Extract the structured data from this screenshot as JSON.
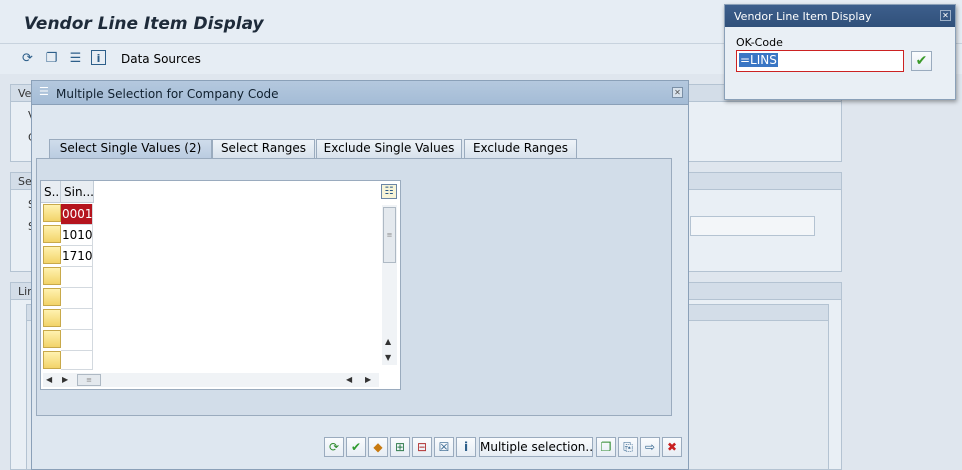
{
  "main": {
    "title": "Vendor Line Item Display",
    "toolbar": {
      "icons": [
        "execute-icon",
        "get-variant-icon",
        "dynamic-selection-icon",
        "info-icon"
      ],
      "data_sources_label": "Data Sources"
    },
    "background_fragments": [
      "Ve",
      "V",
      "C",
      "Se",
      "S",
      "S",
      "Lin"
    ]
  },
  "dialog": {
    "title": "Multiple Selection for Company Code",
    "tabs": [
      {
        "label": "Select Single Values (2)",
        "active": true
      },
      {
        "label": "Select Ranges",
        "active": false
      },
      {
        "label": "Exclude Single Values",
        "active": false
      },
      {
        "label": "Exclude Ranges",
        "active": false
      }
    ],
    "grid": {
      "columns": [
        "S..",
        "Sin..."
      ],
      "rows": [
        "0001",
        "1010",
        "1710",
        "",
        "",
        "",
        "",
        ""
      ]
    },
    "buttons": {
      "multiple_selection_label": "Multiple selection..",
      "icons": [
        "check-icon",
        "execute-icon",
        "ok-icon",
        "insert-row-icon",
        "delete-row-icon",
        "delete-all-icon",
        "info-icon",
        "copy-icon",
        "upload-icon",
        "import-icon",
        "cancel-icon"
      ]
    }
  },
  "okcode_popup": {
    "title": "Vendor Line Item Display",
    "label": "OK-Code",
    "value": "=LINS"
  },
  "colors": {
    "selected_cell": "#b5141d",
    "popup_header": "#3d5f8c",
    "enter_check": "#3a9a2a"
  }
}
